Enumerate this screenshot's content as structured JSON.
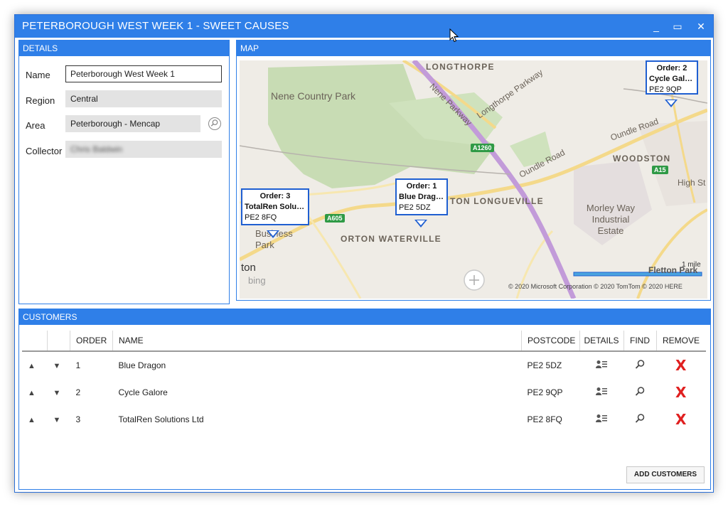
{
  "window": {
    "title": "PETERBOROUGH WEST WEEK 1 - SWEET CAUSES",
    "minimize_glyph": "_",
    "maximize_glyph": "▭",
    "close_glyph": "✕"
  },
  "details": {
    "header": "DETAILS",
    "fields": {
      "name": {
        "label": "Name",
        "value": "Peterborough West Week 1"
      },
      "region": {
        "label": "Region",
        "value": "Central"
      },
      "area": {
        "label": "Area",
        "value": "Peterborough - Mencap"
      },
      "collector": {
        "label": "Collector",
        "value": "Chris Baldwin"
      }
    }
  },
  "map": {
    "header": "MAP",
    "labels": {
      "longthorpe": "LONGTHORPE",
      "nene_country_park": "Nene Country Park",
      "nene_parkway": "Nene Parkway",
      "longthorpe_parkway": "Longthorpe Parkway",
      "oundle_road_east": "Oundle Road",
      "oundle_road_mid": "Oundle Road",
      "woodston": "WOODSTON",
      "high_st": "High St",
      "orton_longueville": "TON LONGUEVILLE",
      "orton_waterville": "ORTON WATERVILLE",
      "morley_way": "Morley Way Industrial Estate",
      "business_park": "Business Park",
      "ton": "ton",
      "bing": "bing",
      "a1260": "A1260",
      "a605": "A605",
      "a15": "A15",
      "scale": "1 mile",
      "copyright": "© 2020 Microsoft Corporation   © 2020 TomTom © 2020 HERE",
      "fletton": "Fletton Park"
    },
    "pins": [
      {
        "order": "Order: 1",
        "name": "Blue Dragon",
        "postcode": "PE2 5DZ"
      },
      {
        "order": "Order: 2",
        "name": "Cycle Galore",
        "postcode": "PE2 9QP"
      },
      {
        "order": "Order: 3",
        "name": "TotalRen Soluti...",
        "postcode": "PE2 8FQ"
      }
    ]
  },
  "customers": {
    "header": "CUSTOMERS",
    "columns": [
      "ORDER",
      "NAME",
      "POSTCODE",
      "DETAILS",
      "FIND",
      "REMOVE"
    ],
    "rows": [
      {
        "order": "1",
        "name": "Blue Dragon",
        "postcode": "PE2 5DZ"
      },
      {
        "order": "2",
        "name": "Cycle Galore",
        "postcode": "PE2 9QP"
      },
      {
        "order": "3",
        "name": "TotalRen Solutions Ltd",
        "postcode": "PE2 8FQ"
      }
    ],
    "up_glyph": "▲",
    "down_glyph": "▼",
    "remove_glyph": "X",
    "add_button": "ADD CUSTOMERS"
  },
  "colors": {
    "accent": "#2f7fe8",
    "pin": "#1f5fd1",
    "remove": "#e02020"
  }
}
